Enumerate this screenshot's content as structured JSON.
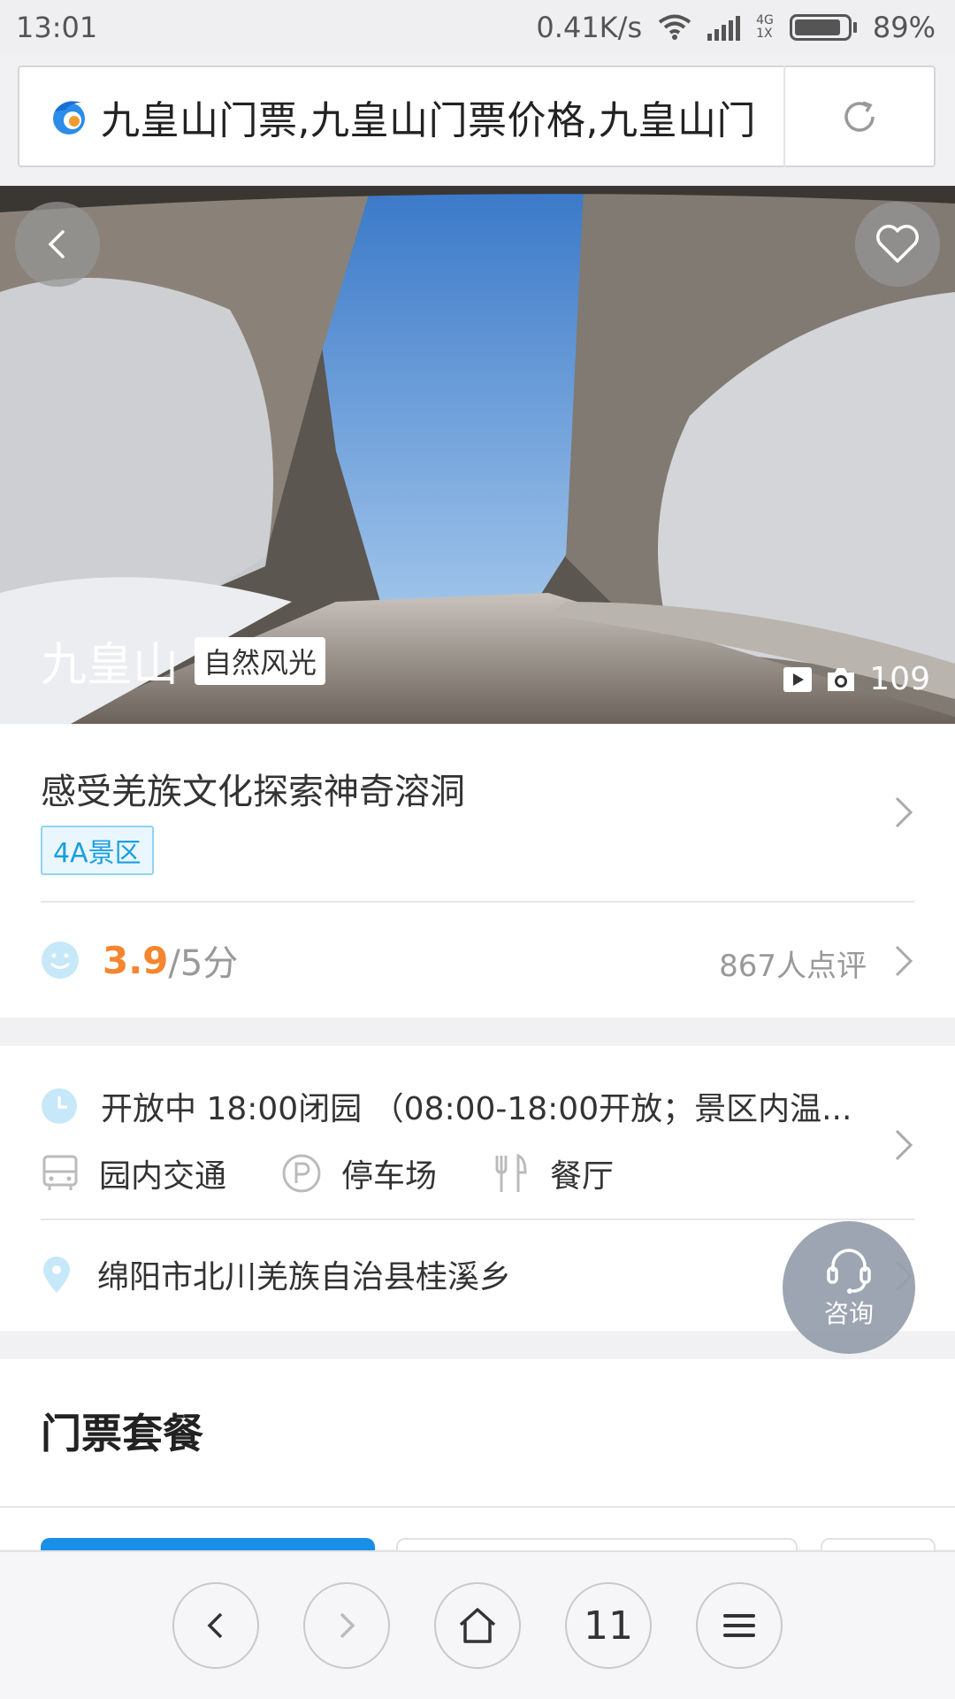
{
  "status_bar": {
    "time": "13:01",
    "speed": "0.41K/s",
    "network": "4G",
    "network_sub": "1X",
    "battery_percent": 89,
    "battery_label": "89%"
  },
  "address_bar": {
    "url_title": "九皇山门票,九皇山门票价格,九皇山门",
    "logo_icon": "browser-logo-icon",
    "reload_icon": "reload-icon"
  },
  "hero": {
    "name": "九皇山",
    "category_tag": "自然风光",
    "photo_count": "109",
    "back_icon": "chevron-left-icon",
    "favorite_icon": "heart-icon"
  },
  "intro": {
    "slogan": "感受羌族文化探索神奇溶洞",
    "level_tag": "4A景区"
  },
  "rating": {
    "score": "3.9",
    "max": "/5分",
    "reviews": "867人点评"
  },
  "info": {
    "hours": "开放中 18:00闭园 （08:00-18:00开放；景区内温...",
    "facilities": [
      "园内交通",
      "停车场",
      "餐厅"
    ],
    "address": "绵阳市北川羌族自治县桂溪乡"
  },
  "consult": {
    "label": "咨询"
  },
  "tickets": {
    "title": "门票套餐"
  },
  "bottom_nav": {
    "tab_count": "11"
  },
  "colors": {
    "accent_orange": "#f5852f",
    "accent_blue": "#1a9fe0",
    "tab_active": "#1a8fe8"
  }
}
